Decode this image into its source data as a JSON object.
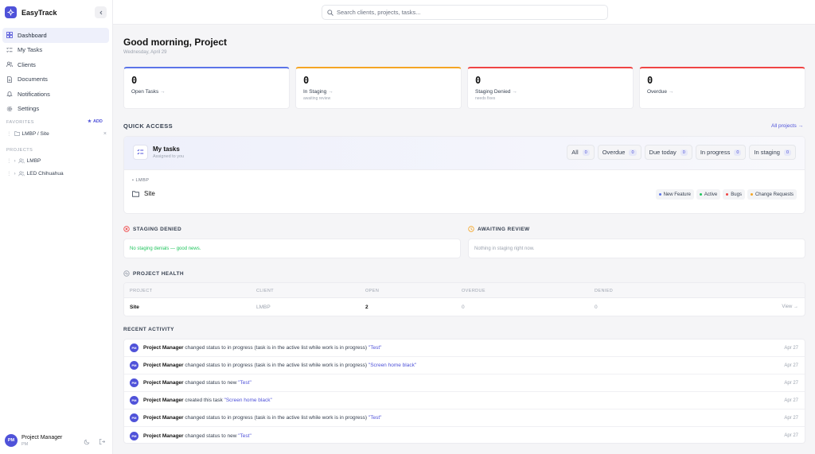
{
  "app": {
    "name": "EasyTrack"
  },
  "sidebar": {
    "nav": [
      {
        "label": "Dashboard",
        "icon": "grid-icon",
        "active": true
      },
      {
        "label": "My Tasks",
        "icon": "list-check-icon"
      },
      {
        "label": "Clients",
        "icon": "users-icon"
      },
      {
        "label": "Documents",
        "icon": "document-icon"
      },
      {
        "label": "Notifications",
        "icon": "bell-icon"
      },
      {
        "label": "Settings",
        "icon": "gear-icon"
      }
    ],
    "favorites_label": "FAVORITES",
    "add_label": "ADD",
    "favorites": [
      {
        "label": "LMBP / Site"
      }
    ],
    "projects_label": "PROJECTS",
    "projects": [
      {
        "label": "LMBP"
      },
      {
        "label": "LED Chihuahua"
      }
    ]
  },
  "user": {
    "initials": "PM",
    "name": "Project Manager",
    "role": "PM"
  },
  "search": {
    "placeholder": "Search clients, projects, tasks..."
  },
  "header": {
    "greeting": "Good morning, Project",
    "date": "Wednesday, April 29"
  },
  "stats": [
    {
      "value": "0",
      "label": "Open Tasks",
      "sub": "",
      "color": "#5b74e8"
    },
    {
      "value": "0",
      "label": "In Staging",
      "sub": "awaiting review",
      "color": "#f5a524"
    },
    {
      "value": "0",
      "label": "Staging Denied",
      "sub": "needs fixes",
      "color": "#ef4444"
    },
    {
      "value": "0",
      "label": "Overdue",
      "sub": "",
      "color": "#ef4444"
    }
  ],
  "quick_access": {
    "title": "QUICK ACCESS",
    "all_projects": "All projects →",
    "my_tasks_title": "My tasks",
    "my_tasks_sub": "Assigned to you",
    "filters": [
      {
        "label": "All",
        "count": "0"
      },
      {
        "label": "Overdue",
        "count": "0"
      },
      {
        "label": "Due today",
        "count": "0"
      },
      {
        "label": "In progress",
        "count": "0"
      },
      {
        "label": "In staging",
        "count": "0"
      }
    ],
    "client": "LMBP",
    "project": "Site",
    "tags": [
      {
        "label": "New Feature",
        "color": "#5b74e8"
      },
      {
        "label": "Active",
        "color": "#22c55e"
      },
      {
        "label": "Bugs",
        "color": "#ef4444"
      },
      {
        "label": "Change Requests",
        "color": "#f5a524"
      }
    ]
  },
  "staging_denied": {
    "title": "STAGING DENIED",
    "message": "No staging denials — good news.",
    "color": "#22c55e"
  },
  "awaiting_review": {
    "title": "AWAITING REVIEW",
    "message": "Nothing in staging right now.",
    "color": "#f5a524"
  },
  "project_health": {
    "title": "PROJECT HEALTH",
    "columns": [
      "PROJECT",
      "CLIENT",
      "OPEN",
      "OVERDUE",
      "DENIED"
    ],
    "rows": [
      {
        "project": "Site",
        "client": "LMBP",
        "open": "2",
        "overdue": "0",
        "denied": "0",
        "action": "View →"
      }
    ]
  },
  "recent_activity": {
    "title": "RECENT ACTIVITY",
    "items": [
      {
        "actor": "Project Manager",
        "action": "changed status to in progress (task is in the active list while work is in progress)",
        "target": "\"Test\"",
        "date": "Apr 27"
      },
      {
        "actor": "Project Manager",
        "action": "changed status to in progress (task is in the active list while work is in progress)",
        "target": "\"Screen home black\"",
        "date": "Apr 27"
      },
      {
        "actor": "Project Manager",
        "action": "changed status to new",
        "target": "\"Test\"",
        "date": "Apr 27"
      },
      {
        "actor": "Project Manager",
        "action": "created this task",
        "target": "\"Screen home black\"",
        "date": "Apr 27"
      },
      {
        "actor": "Project Manager",
        "action": "changed status to in progress (task is in the active list while work is in progress)",
        "target": "\"Test\"",
        "date": "Apr 27"
      },
      {
        "actor": "Project Manager",
        "action": "changed status to new",
        "target": "\"Test\"",
        "date": "Apr 27"
      }
    ]
  }
}
